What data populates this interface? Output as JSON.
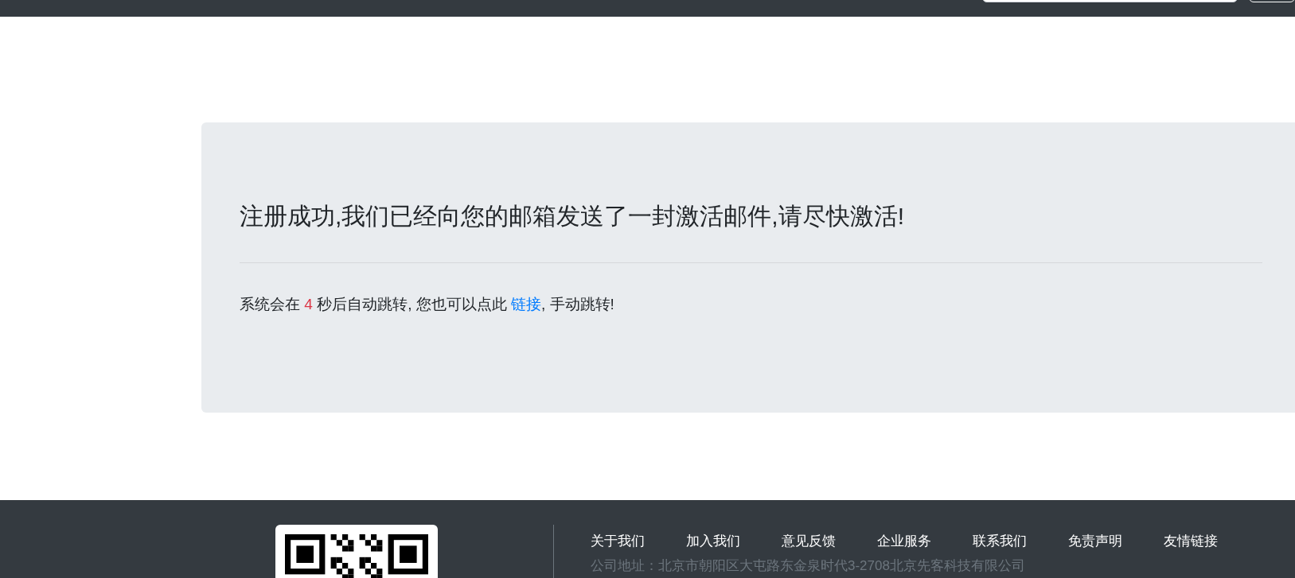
{
  "message": {
    "title": "注册成功,我们已经向您的邮箱发送了一封激活邮件,请尽快激活!",
    "redirect": {
      "before": "系统会在",
      "seconds": "4",
      "middle": "秒后自动跳转, 您也可以点此",
      "link": "链接",
      "after": ", 手动跳转!"
    }
  },
  "footer": {
    "links": [
      "关于我们",
      "加入我们",
      "意见反馈",
      "企业服务",
      "联系我们",
      "免责声明",
      "友情链接"
    ],
    "address": "公司地址：北京市朝阳区大屯路东金泉时代3-2708北京先客科技有限公司"
  }
}
